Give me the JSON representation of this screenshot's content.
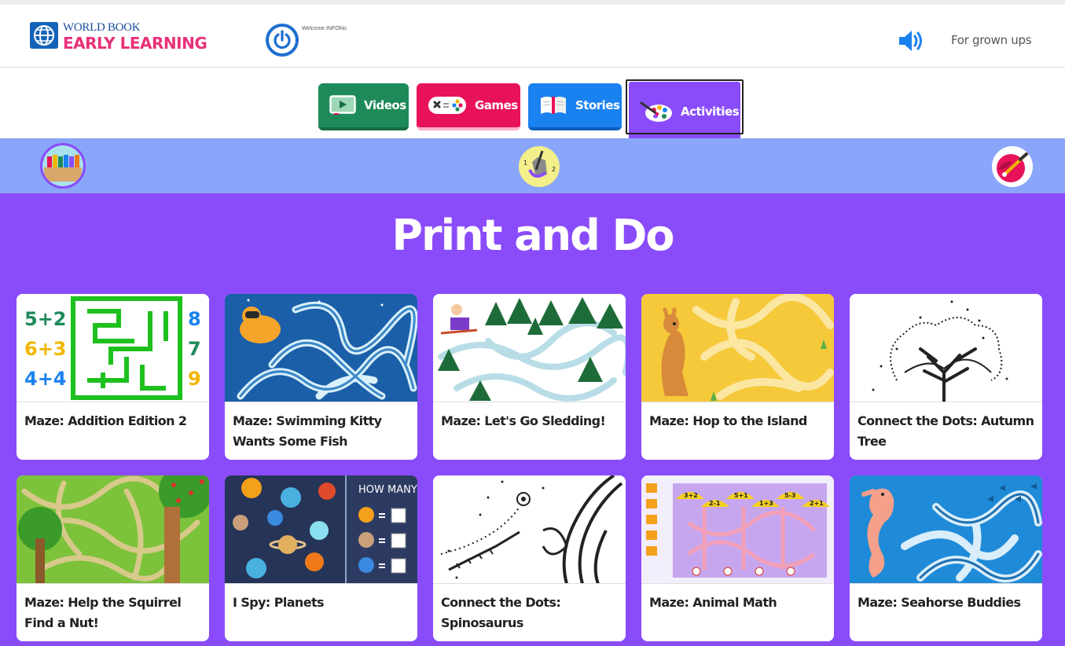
{
  "header": {
    "logo_top": "WORLD BOOK",
    "logo_bottom_1": "EARLY",
    "logo_bottom_2": "LEARNING",
    "welcome": "Welcome INFOhio",
    "grown_ups": "For grown ups"
  },
  "tabs": [
    {
      "label": "Videos",
      "color": "#1e8a5a",
      "icon": "video-player-icon"
    },
    {
      "label": "Games",
      "color": "#e8125a",
      "icon": "game-controller-icon"
    },
    {
      "label": "Stories",
      "color": "#1a82f0",
      "icon": "open-book-icon"
    },
    {
      "label": "Activities",
      "color": "#8a4cfa",
      "icon": "paint-palette-icon",
      "selected": true
    }
  ],
  "subnav": [
    {
      "icon": "crayons-icon"
    },
    {
      "icon": "connect-the-dots-icon",
      "labels": [
        "1",
        "2"
      ]
    },
    {
      "icon": "paint-brush-icon"
    }
  ],
  "main": {
    "title": "Print and Do",
    "background": "#8a4cfa",
    "cards": [
      {
        "title": "Maze: Addition Edition 2",
        "thumb": "addition-maze"
      },
      {
        "title": "Maze: Swimming Kitty Wants Some Fish",
        "thumb": "kitty-maze"
      },
      {
        "title": "Maze: Let's Go Sledding!",
        "thumb": "sledding-maze"
      },
      {
        "title": "Maze: Hop to the Island",
        "thumb": "kangaroo-maze"
      },
      {
        "title": "Connect the Dots: Autumn Tree",
        "thumb": "tree-dots"
      },
      {
        "title": "Maze: Help the Squirrel Find a Nut!",
        "thumb": "squirrel-maze"
      },
      {
        "title": "I Spy: Planets",
        "thumb": "planets"
      },
      {
        "title": "Connect the Dots: Spinosaurus",
        "thumb": "spinosaurus-dots"
      },
      {
        "title": "Maze: Animal Math",
        "thumb": "animal-math-maze"
      },
      {
        "title": "Maze: Seahorse Buddies",
        "thumb": "seahorse-maze"
      }
    ]
  },
  "thumb_text": {
    "addition_left": [
      "5+2",
      "6+3",
      "4+4"
    ],
    "addition_right": [
      "8",
      "7",
      "9"
    ],
    "how_many": "HOW MANY?",
    "animal_math": [
      "3+2",
      "2-1",
      "5+1",
      "1+3",
      "5-3",
      "2+1"
    ]
  }
}
